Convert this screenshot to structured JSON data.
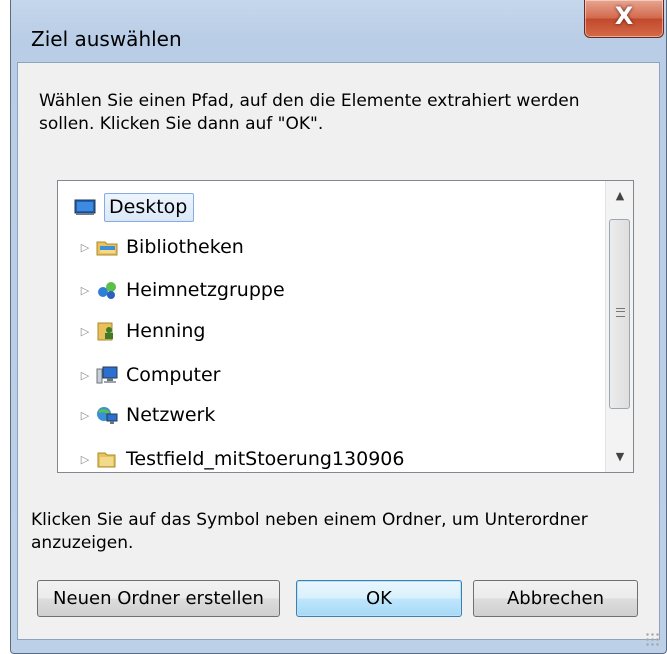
{
  "window": {
    "title": "Ziel auswählen",
    "close_label": "X"
  },
  "instructions": "Wählen Sie einen Pfad, auf den die Elemente extrahiert werden sollen. Klicken Sie dann auf \"OK\".",
  "tree": {
    "items": [
      {
        "label": "Desktop",
        "icon": "desktop-icon",
        "selected": true,
        "expandable": false
      },
      {
        "label": "Bibliotheken",
        "icon": "libraries-icon",
        "expandable": true
      },
      {
        "label": "Heimnetzgruppe",
        "icon": "homegroup-icon",
        "expandable": true
      },
      {
        "label": "Henning",
        "icon": "user-folder-icon",
        "expandable": true
      },
      {
        "label": "Computer",
        "icon": "computer-icon",
        "expandable": true
      },
      {
        "label": "Netzwerk",
        "icon": "network-icon",
        "expandable": true
      },
      {
        "label": "Testfield_mitStoerung130906",
        "icon": "folder-icon",
        "expandable": true
      }
    ]
  },
  "hint": "Klicken Sie auf das Symbol neben einem Ordner, um Unterordner anzuzeigen.",
  "buttons": {
    "new_folder": "Neuen Ordner erstellen",
    "ok": "OK",
    "cancel": "Abbrechen"
  },
  "colors": {
    "selection_border": "#84acdd",
    "default_button": "#bee6fd",
    "close_button": "#c24a2c"
  }
}
